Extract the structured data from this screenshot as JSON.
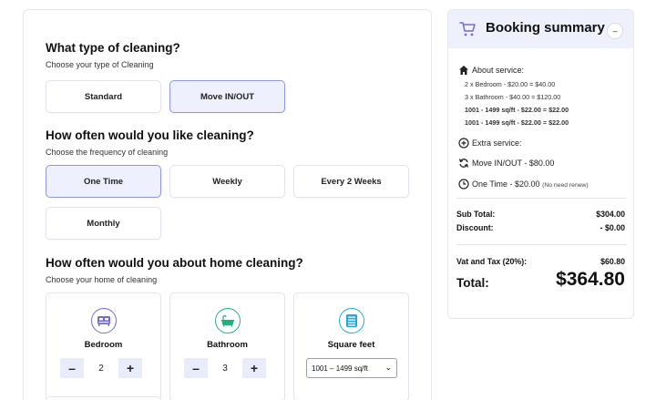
{
  "cleaning_type": {
    "title": "What type of cleaning?",
    "subtitle": "Choose your type of Cleaning",
    "options": [
      "Standard",
      "Move IN/OUT"
    ],
    "selected": "Move IN/OUT"
  },
  "frequency": {
    "title": "How often would you like cleaning?",
    "subtitle": "Choose the frequency of cleaning",
    "options": [
      "One Time",
      "Weekly",
      "Every 2 Weeks",
      "Monthly"
    ],
    "selected": "One Time"
  },
  "home": {
    "title": "How often would you about home cleaning?",
    "subtitle": "Choose your home of cleaning",
    "cards": [
      {
        "label": "Bedroom",
        "icon": "bed-icon",
        "value": "2"
      },
      {
        "label": "Bathroom",
        "icon": "bathtub-icon",
        "value": "3"
      },
      {
        "label": "Square feet",
        "icon": "square-feet-icon",
        "select_value": "1001 – 1499 sq/ft"
      }
    ],
    "stepper_minus": "–",
    "stepper_plus": "+"
  },
  "summary": {
    "title": "Booking summary",
    "collapse_label": "–",
    "about_label": "About service:",
    "about_items": [
      "2 x Bedroom - $20.00 = $40.00",
      "3 x Bathroom - $40.00 = $120.00",
      "1001 - 1499 sq/ft - $22.00 = $22.00",
      "1001 - 1499 sq/ft - $22.00 = $22.00"
    ],
    "extra_label": "Extra service:",
    "move_label": "Move IN/OUT - $80.00",
    "one_time_label": "One Time - $20.00",
    "one_time_note": "(No need renew)",
    "subtotal_label": "Sub Total:",
    "subtotal_value": "$304.00",
    "discount_label": "Discount:",
    "discount_value": "- $0.00",
    "vat_label": "Vat and Tax (20%):",
    "vat_value": "$60.80",
    "total_label": "Total:",
    "total_value": "$364.80"
  },
  "colors": {
    "accent": "#6f6cd8",
    "selected_bg": "#eef0fd",
    "summary_header_bg": "#eef1fc",
    "stepper_bg": "#e8ecfb"
  }
}
